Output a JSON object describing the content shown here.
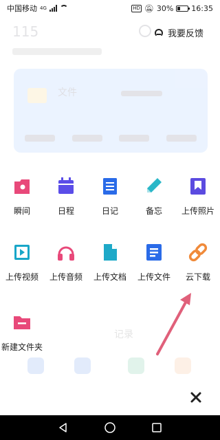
{
  "status_bar": {
    "carrier": "中国移动",
    "network_tag": "4G",
    "battery": "30%",
    "time": "16:35"
  },
  "background": {
    "count": "115",
    "card_title": "文件",
    "section_title": "记录"
  },
  "feedback": {
    "label": "我要反馈",
    "icon": "headset-icon"
  },
  "menu": {
    "items": [
      {
        "label": "瞬间",
        "icon": "moment-icon",
        "color": "#e8497a"
      },
      {
        "label": "日程",
        "icon": "calendar-icon",
        "color": "#5a4de8"
      },
      {
        "label": "日记",
        "icon": "diary-icon",
        "color": "#2a6be8"
      },
      {
        "label": "备忘",
        "icon": "pencil-icon",
        "color": "#2ab7c8"
      },
      {
        "label": "上传照片",
        "icon": "photo-bookmark-icon",
        "color": "#5b4be0"
      },
      {
        "label": "上传视频",
        "icon": "video-play-icon",
        "color": "#18a6c8"
      },
      {
        "label": "上传音频",
        "icon": "headphones-icon",
        "color": "#e8497a"
      },
      {
        "label": "上传文档",
        "icon": "document-icon",
        "color": "#1ea9c8"
      },
      {
        "label": "上传文件",
        "icon": "file-list-icon",
        "color": "#2a6be8"
      },
      {
        "label": "云下载",
        "icon": "link-icon",
        "color": "#f08a3a"
      },
      {
        "label": "新建文件夹",
        "icon": "new-folder-icon",
        "color": "#e8497a"
      }
    ]
  },
  "close": {
    "icon": "close-icon"
  },
  "navbar": {
    "back": "back-icon",
    "home": "home-icon",
    "recent": "recent-apps-icon"
  },
  "annotation": {
    "arrow_color": "#e0607a"
  }
}
